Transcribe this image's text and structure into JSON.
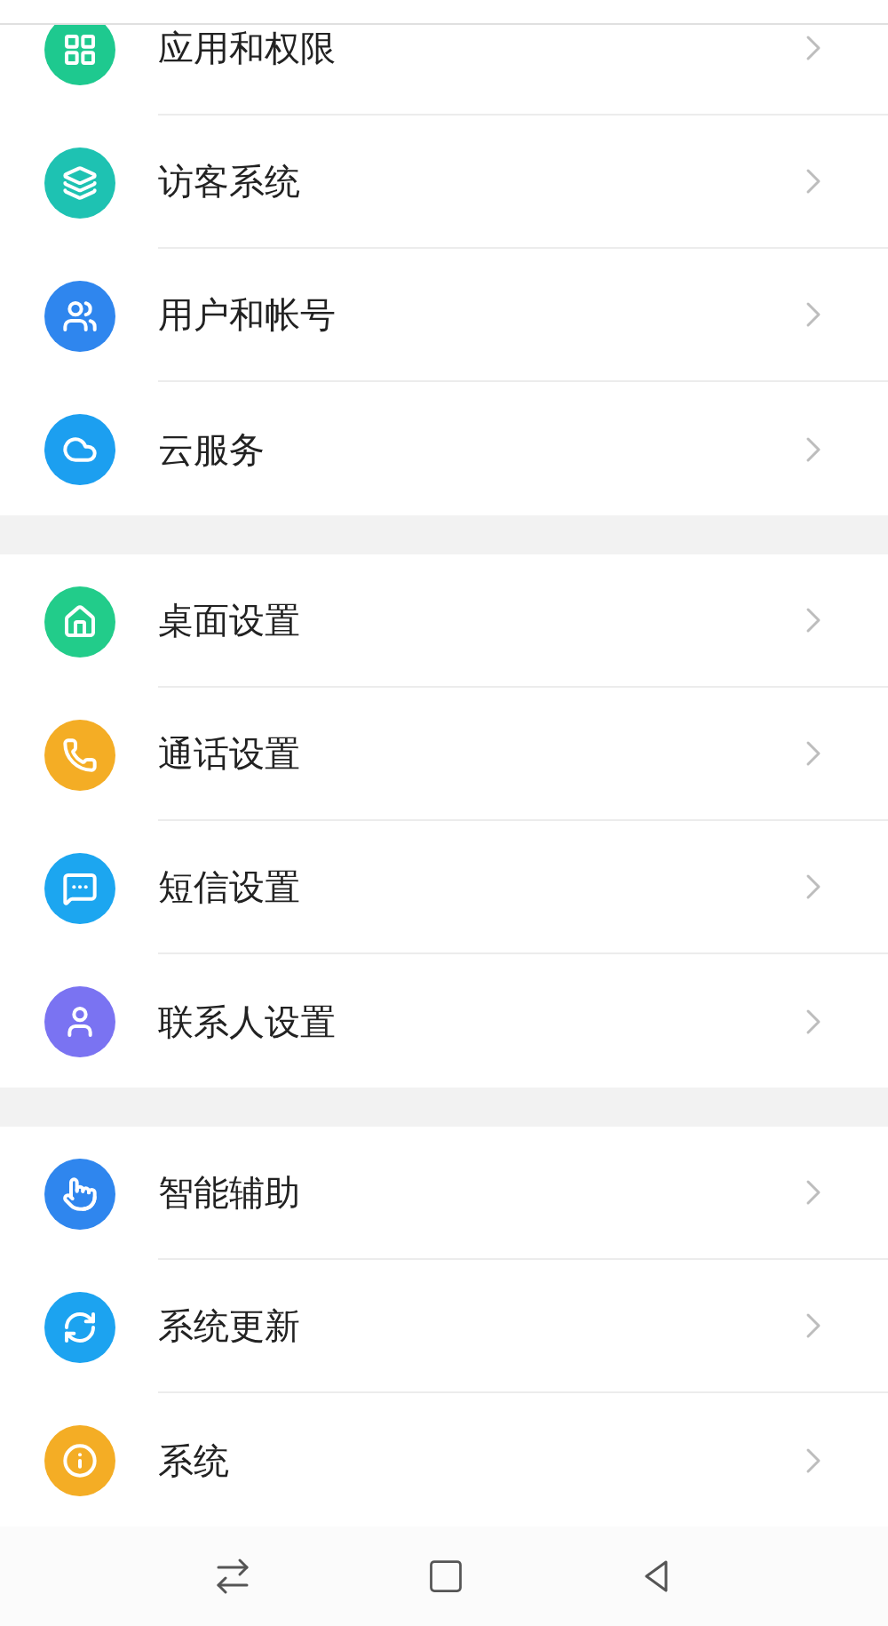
{
  "sections": [
    {
      "items": [
        {
          "label": "应用和权限",
          "color": "#1ec98f"
        },
        {
          "label": "访客系统",
          "color": "#1ec2b2"
        },
        {
          "label": "用户和帐号",
          "color": "#2f86ee"
        },
        {
          "label": "云服务",
          "color": "#1c9ff0"
        }
      ]
    },
    {
      "items": [
        {
          "label": "桌面设置",
          "color": "#22cc8a"
        },
        {
          "label": "通话设置",
          "color": "#f4ad25"
        },
        {
          "label": "短信设置",
          "color": "#1ca6f0"
        },
        {
          "label": "联系人设置",
          "color": "#7a73f2"
        }
      ]
    },
    {
      "items": [
        {
          "label": "智能辅助",
          "color": "#2f86ee"
        },
        {
          "label": "系统更新",
          "color": "#1ca3f0"
        },
        {
          "label": "系统",
          "color": "#f4ad25"
        }
      ]
    }
  ]
}
